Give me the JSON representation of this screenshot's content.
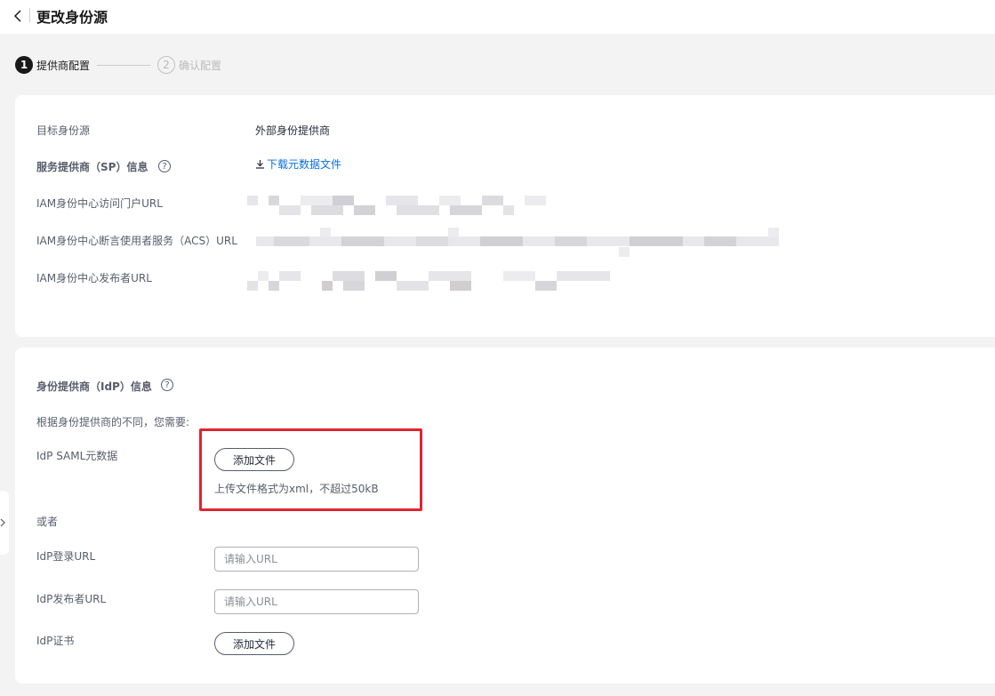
{
  "header": {
    "title": "更改身份源"
  },
  "steps": [
    {
      "number": "1",
      "label": "提供商配置"
    },
    {
      "number": "2",
      "label": "确认配置"
    }
  ],
  "sp_section": {
    "target_label": "目标身份源",
    "target_value": "外部身份提供商",
    "sp_info_label": "服务提供商（SP）信息",
    "download_link": "下载元数据文件",
    "portal_url_label": "IAM身份中心访问门户URL",
    "acs_url_label": "IAM身份中心断言使用者服务（ACS）URL",
    "issuer_url_label": "IAM身份中心发布者URL"
  },
  "idp_section": {
    "title": "身份提供商（IdP）信息",
    "description": "根据身份提供商的不同，您需要:",
    "saml_label": "IdP SAML元数据",
    "add_file_button": "添加文件",
    "upload_hint": "上传文件格式为xml，不超过50kB",
    "or_text": "或者",
    "login_url_label": "IdP登录URL",
    "login_url_placeholder": "请输入URL",
    "issuer_url_label": "IdP发布者URL",
    "issuer_url_placeholder": "请输入URL",
    "cert_label": "IdP证书",
    "cert_button": "添加文件"
  },
  "colors": {
    "link": "#0a6ed9",
    "highlight": "#e0242e",
    "step_active": "#191919"
  },
  "icons": [
    "chevron-left-icon",
    "help-icon",
    "download-icon",
    "chevron-right-icon"
  ]
}
